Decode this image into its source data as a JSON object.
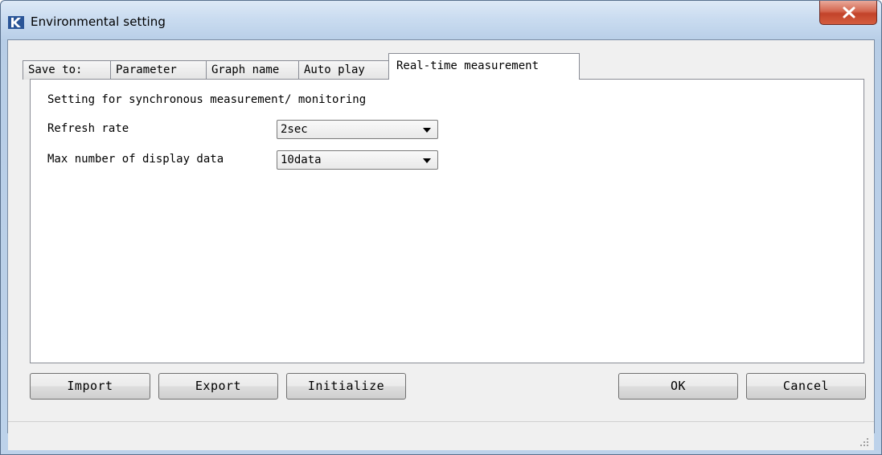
{
  "window": {
    "title": "Environmental setting",
    "app_icon": "k-logo-icon",
    "close_icon": "close-icon"
  },
  "tabs": [
    {
      "label": "Save to:",
      "active": false
    },
    {
      "label": "Parameter",
      "active": false
    },
    {
      "label": "Graph name",
      "active": false
    },
    {
      "label": "Auto play",
      "active": false
    },
    {
      "label": "Real-time measurement",
      "active": true
    }
  ],
  "panel": {
    "section_title": "Setting for synchronous measurement/ monitoring",
    "fields": [
      {
        "label": "Refresh rate",
        "value": "2sec"
      },
      {
        "label": "Max number of display data",
        "value": "10data"
      }
    ]
  },
  "buttons": {
    "import": "Import",
    "export": "Export",
    "initialize": "Initialize",
    "ok": "OK",
    "cancel": "Cancel"
  },
  "colors": {
    "titlebar": "#c9dbef",
    "close_button": "#c2432a",
    "panel_bg": "#ffffff",
    "client_bg": "#f0f0f0"
  }
}
